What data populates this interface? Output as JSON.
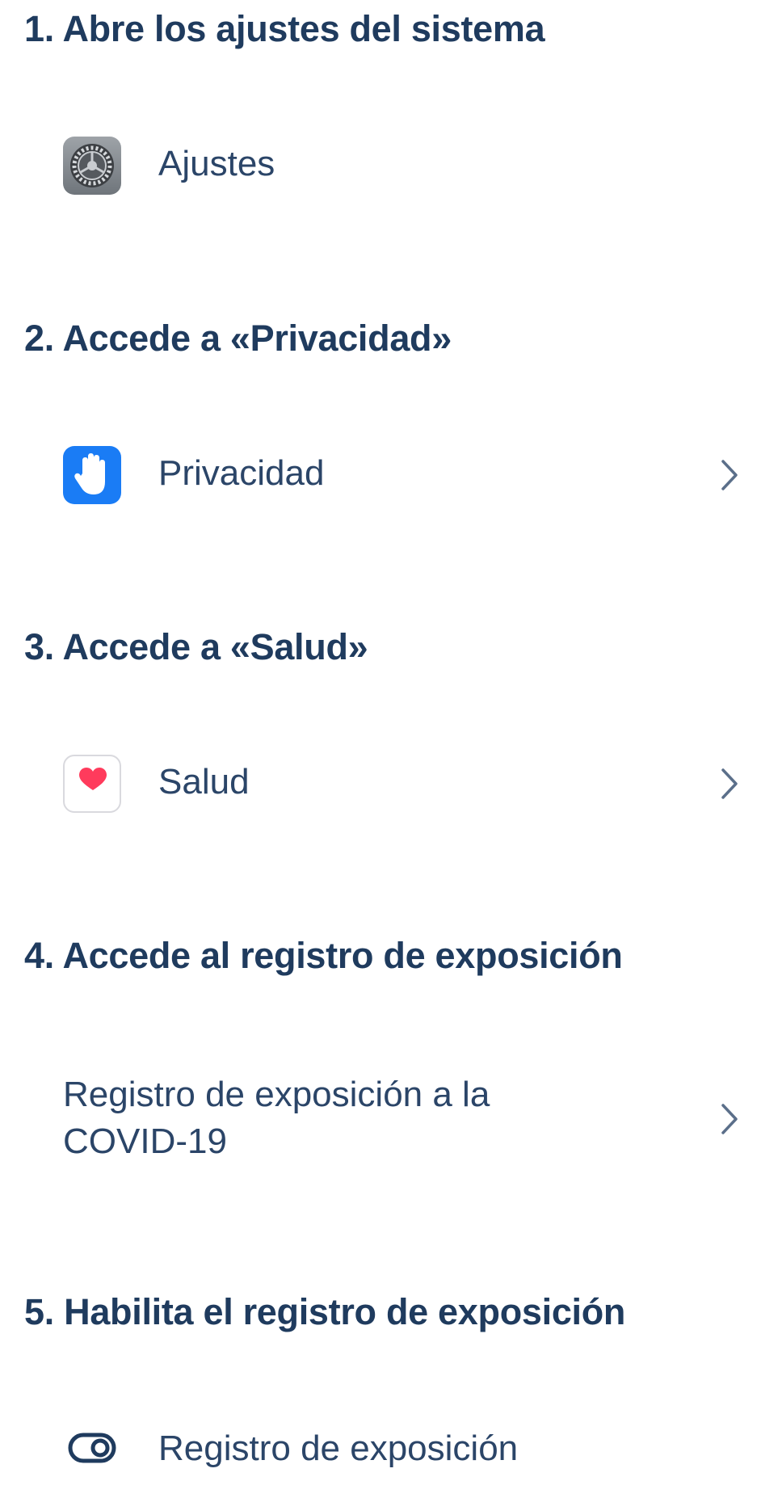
{
  "steps": [
    {
      "title": "1. Abre los ajustes del sistema",
      "item": {
        "label": "Ajustes",
        "icon": "settings-gear-icon",
        "has_chevron": false
      }
    },
    {
      "title": "2. Accede a «Privacidad»",
      "item": {
        "label": "Privacidad",
        "icon": "privacy-hand-icon",
        "has_chevron": true
      }
    },
    {
      "title": "3. Accede a «Salud»",
      "item": {
        "label": "Salud",
        "icon": "health-heart-icon",
        "has_chevron": true
      }
    },
    {
      "title": "4. Accede al registro de exposición",
      "item": {
        "label_line1": "Registro de exposición a la",
        "label_line2": "COVID-19",
        "icon": null,
        "has_chevron": true
      }
    },
    {
      "title": "5. Habilita el registro de exposición",
      "item": {
        "label": "Registro de exposición",
        "icon": "toggle-icon",
        "has_chevron": false
      }
    }
  ],
  "colors": {
    "heading": "#1f3b5e",
    "label": "#2b4568",
    "privacy_blue": "#1a7cf5",
    "heart_red": "#ff3b5c",
    "chevron": "#5b6f8a"
  }
}
